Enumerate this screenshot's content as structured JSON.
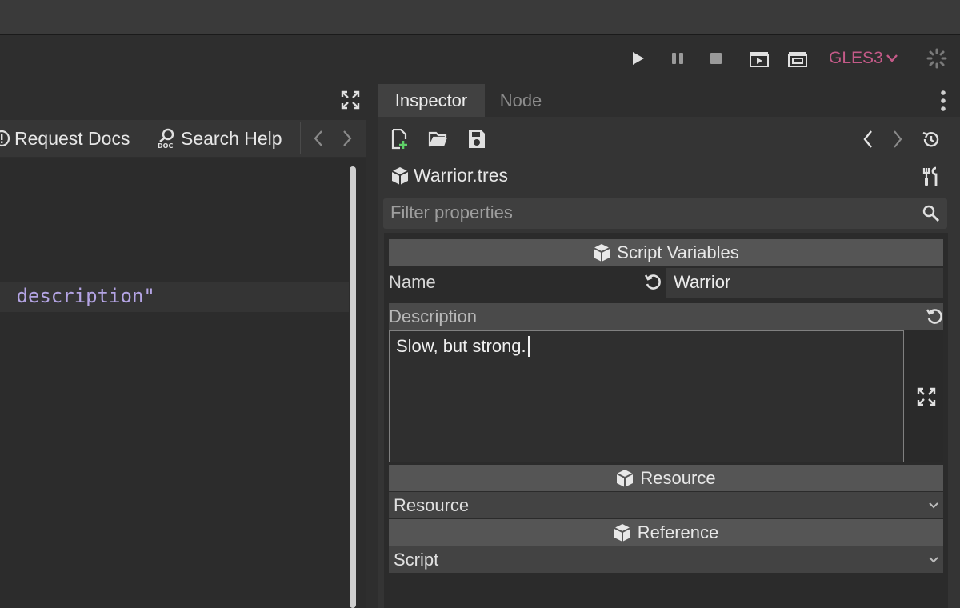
{
  "toolbar": {
    "play_icon": "play-icon",
    "pause_icon": "pause-icon",
    "stop_icon": "stop-icon",
    "renderer": "GLES3",
    "renderer_color": "#c45a88"
  },
  "script_panel": {
    "request_docs": "Request Docs",
    "search_help": "Search Help",
    "code_line": " description\""
  },
  "inspector": {
    "tabs": [
      "Inspector",
      "Node"
    ],
    "resource_name": "Warrior.tres",
    "filter_placeholder": "Filter properties",
    "sections": {
      "script_variables": "Script Variables",
      "resource": "Resource",
      "reference": "Reference"
    },
    "properties": {
      "name_label": "Name",
      "name_value": "Warrior",
      "description_label": "Description",
      "description_value": "Slow, but strong.",
      "resource_value": "Resource",
      "script_value": "Script"
    }
  }
}
